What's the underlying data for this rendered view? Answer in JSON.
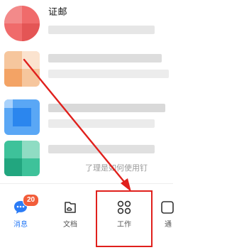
{
  "chat_list": {
    "items": [
      {
        "title": "证邮",
        "preview": ""
      },
      {
        "title": "",
        "preview": ""
      },
      {
        "title": "",
        "preview": ""
      },
      {
        "title": "",
        "preview": ""
      },
      {
        "title": "",
        "preview": "了理是如何使用钉"
      }
    ]
  },
  "tabbar": {
    "tabs": [
      {
        "label": "消息",
        "badge": "20",
        "icon": "chat-bubble-icon"
      },
      {
        "label": "文档",
        "icon": "cloud-doc-icon"
      },
      {
        "label": "工作",
        "icon": "grid-apps-icon"
      },
      {
        "label": "通",
        "icon": "contacts-icon"
      }
    ]
  },
  "colors": {
    "accent": "#2b7cf6",
    "badge": "#f25d3a",
    "highlight": "#e0201c"
  }
}
